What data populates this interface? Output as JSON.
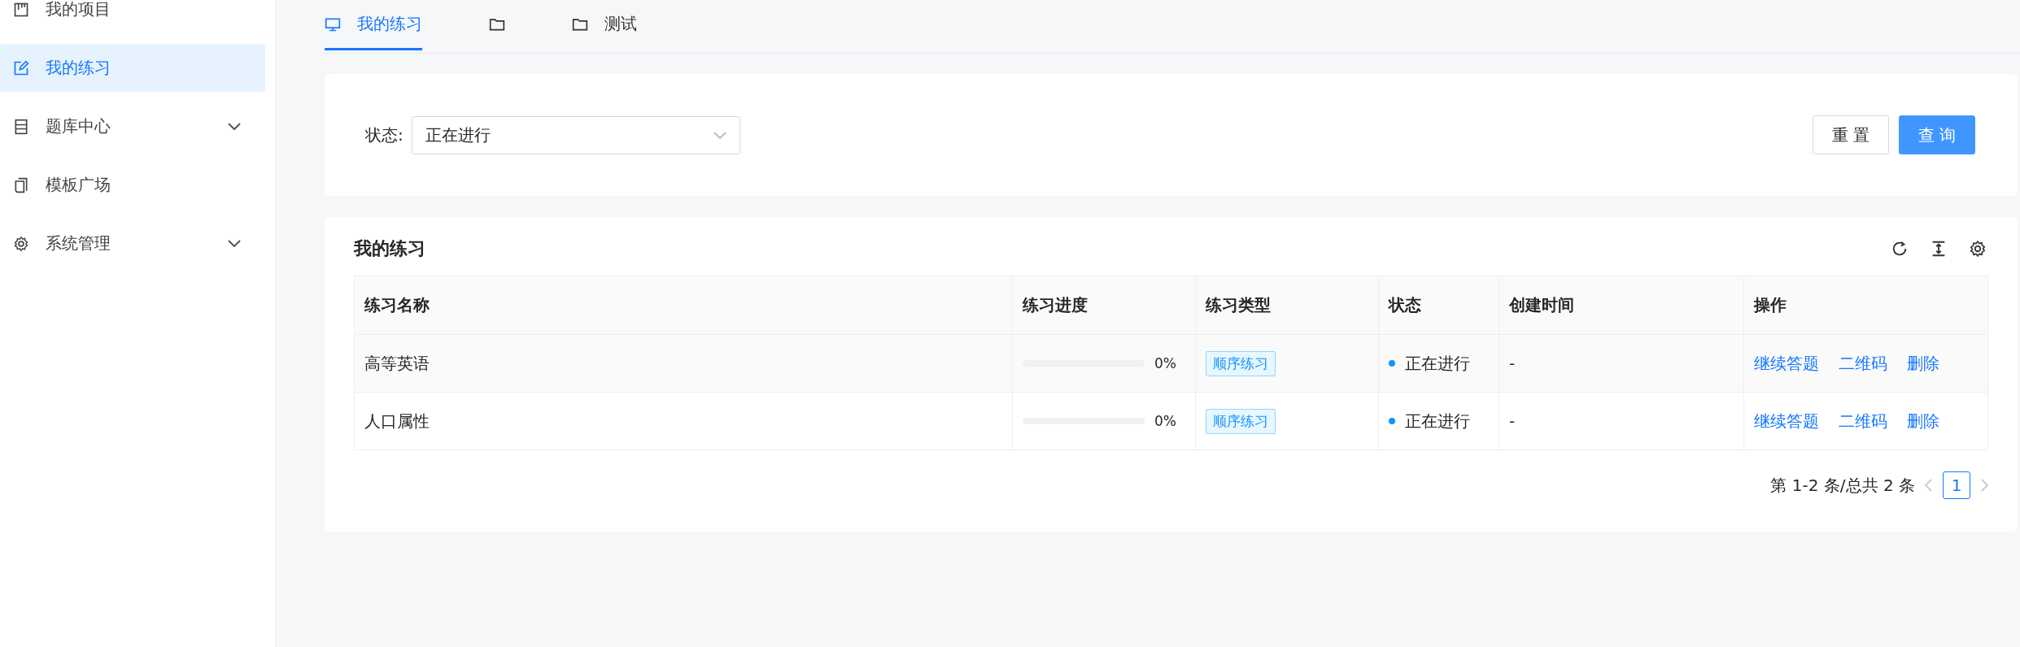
{
  "sidebar": {
    "items": [
      {
        "label": "我的项目",
        "kind": "link",
        "selected": false
      },
      {
        "label": "我的练习",
        "kind": "link",
        "selected": true
      },
      {
        "label": "题库中心",
        "kind": "submenu",
        "selected": false
      },
      {
        "label": "模板广场",
        "kind": "link",
        "selected": false
      },
      {
        "label": "系统管理",
        "kind": "submenu",
        "selected": false
      }
    ]
  },
  "tabs": [
    {
      "label": "我的练习",
      "selected": true
    },
    {
      "selected": false
    },
    {
      "label": "测试",
      "selected": false
    }
  ],
  "filter": {
    "label": "状态:",
    "select": {
      "value": "正在进行"
    },
    "buttons": [
      {
        "label": "重 置",
        "kind": "default"
      },
      {
        "label": "查 询",
        "kind": "primary"
      }
    ]
  },
  "table_card": {
    "title": "我的练习",
    "table": {
      "columns": [
        "练习名称",
        "练习进度",
        "练习类型",
        "状态",
        "创建时间",
        "操作"
      ],
      "rows": [
        {
          "name": "高等英语",
          "progress": {
            "level": 0,
            "reading": "0%"
          },
          "type": "顺序练习",
          "status": {
            "text": "正在进行",
            "color": "#1890ff"
          },
          "created": "-",
          "actions": [
            "继续答题",
            "二维码",
            "删除"
          ]
        },
        {
          "name": "人口属性",
          "progress": {
            "level": 0,
            "reading": "0%"
          },
          "type": "顺序练习",
          "status": {
            "text": "正在进行",
            "color": "#1890ff"
          },
          "created": "-",
          "actions": [
            "继续答题",
            "二维码",
            "删除"
          ]
        }
      ]
    },
    "pagination": {
      "summary": "第 1-2 条/总共 2 条",
      "prev_disabled": true,
      "next_disabled": true,
      "pages": [
        {
          "label": "1",
          "selected": true
        }
      ]
    }
  }
}
